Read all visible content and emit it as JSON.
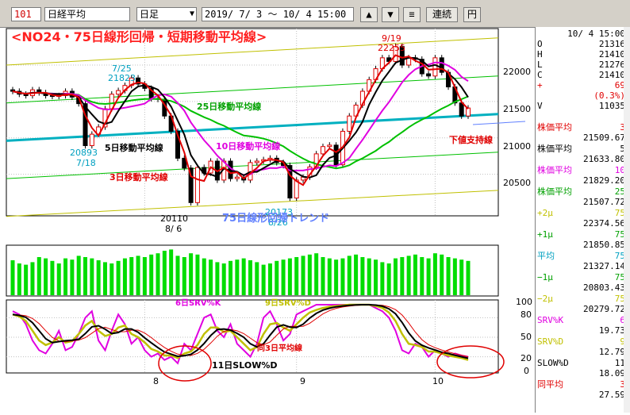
{
  "toolbar": {
    "code": "101",
    "name": "日経平均",
    "period": "日足",
    "dropdown_arrow": "▼",
    "date_range": "2019/ 7/ 3 〜 10/ 4 15:00",
    "up_label": "▲",
    "down_label": "▼",
    "menu_label": "≡",
    "rendou_label": "連続",
    "yen_label": "円"
  },
  "chart": {
    "title": "<NO24・75日線形回帰・短期移動平均線>",
    "annotations": {
      "high_date": "9/19",
      "high_value": "22255",
      "jul_high_date": "7/25",
      "jul_high_value": "21823",
      "jul_low_value": "20893",
      "jul_low_date": "7/18",
      "aug_low_value": "20110",
      "aug_low_date": "8/ 6",
      "aug2_low_value": "20173",
      "aug2_low_date": "8/26",
      "ma25": "25日移動平均線",
      "ma5": "5日移動平均線",
      "ma10": "10日移動平均線",
      "ma3": "3日移動平均線",
      "trend": "75日線形回帰トレンド",
      "support": "下値支持線",
      "srvk": "6日SRV%K",
      "srvd": "9日SRV%D",
      "same": "同3日平均線",
      "slowd": "11日SLOW%D"
    },
    "price_axis": [
      "22000",
      "21500",
      "21000",
      "20500"
    ],
    "osc_axis": [
      "100",
      "80",
      "50",
      "20",
      "0"
    ],
    "x_labels": [
      "8",
      "9",
      "10"
    ]
  },
  "quote": {
    "datetime": "10/ 4 15:00",
    "rows": [
      {
        "l": "O",
        "r": "21316"
      },
      {
        "l": "H",
        "r": "21410"
      },
      {
        "l": "L",
        "r": "21276"
      },
      {
        "l": "C",
        "r": "21410"
      },
      {
        "l": "+",
        "r": "69"
      },
      {
        "l": "",
        "r": "(0.3%)"
      },
      {
        "l": "V",
        "r": "11035"
      }
    ]
  },
  "indicators": [
    {
      "label": "株価平均",
      "n": "3",
      "value": "21509.67",
      "color": "#e00000"
    },
    {
      "label": "株価平均",
      "n": "5",
      "value": "21633.80",
      "color": "#000000"
    },
    {
      "label": "株価平均",
      "n": "10",
      "value": "21829.20",
      "color": "#e000e0"
    },
    {
      "label": "株価平均",
      "n": "25",
      "value": "21507.72",
      "color": "#00a000"
    },
    {
      "label": "+2μ",
      "n": "75",
      "value": "22374.56",
      "color": "#c0c000"
    },
    {
      "label": "+1μ",
      "n": "75",
      "value": "21850.85",
      "color": "#00a000"
    },
    {
      "label": "平均",
      "n": "75",
      "value": "21327.14",
      "color": "#00a0c0"
    },
    {
      "label": "−1μ",
      "n": "75",
      "value": "20803.43",
      "color": "#00a000"
    },
    {
      "label": "−2μ",
      "n": "75",
      "value": "20279.72",
      "color": "#c0c000"
    },
    {
      "label": "SRV%K",
      "n": "6",
      "value": "19.73",
      "color": "#e000e0"
    },
    {
      "label": "SRV%D",
      "n": "9",
      "value": "12.79",
      "color": "#c0c000"
    },
    {
      "label": "SLOW%D",
      "n": "11",
      "value": "18.09",
      "color": "#000000"
    },
    {
      "label": "同平均",
      "n": "3",
      "value": "27.59",
      "color": "#e00000"
    }
  ],
  "colors": {
    "candle_up": "#e00000",
    "candle_down": "#000000",
    "ma3": "#e00000",
    "ma5": "#000000",
    "ma10": "#e000e0",
    "ma25": "#00c000",
    "trend": "#00b0c0",
    "band1": "#00c000",
    "band2": "#c0c000",
    "volume": "#00dd00",
    "circle": "#e00000"
  },
  "chart_data": {
    "type": "line",
    "price_series": {
      "name": "日経平均",
      "close": [
        21640,
        21600,
        21580,
        21660,
        21620,
        21580,
        21570,
        21580,
        21640,
        21560,
        21470,
        20893,
        21050,
        21150,
        21400,
        21600,
        21650,
        21720,
        21823,
        21740,
        21680,
        21540,
        21530,
        21300,
        21090,
        20720,
        20585,
        20110,
        20593,
        20517,
        20680,
        20420,
        20680,
        20440,
        20460,
        20420,
        20660,
        20680,
        20700,
        20720,
        20660,
        20620,
        20173,
        20420,
        20460,
        20600,
        20780,
        20880,
        20900,
        20630,
        21090,
        21300,
        21450,
        21640,
        21800,
        21950,
        22100,
        22050,
        22255,
        22000,
        22100,
        22080,
        21880,
        21850,
        22100,
        21900,
        21700,
        21480,
        21300,
        21410
      ]
    },
    "volume": [
      55,
      50,
      48,
      52,
      60,
      58,
      54,
      50,
      58,
      56,
      62,
      60,
      58,
      55,
      52,
      50,
      54,
      58,
      60,
      62,
      60,
      64,
      66,
      70,
      72,
      62,
      60,
      66,
      64,
      58,
      56,
      52,
      50,
      54,
      56,
      58,
      55,
      52,
      48,
      50,
      54,
      56,
      58,
      60,
      62,
      64,
      66,
      60,
      58,
      56,
      58,
      62,
      64,
      60,
      58,
      56,
      52,
      50,
      58,
      60,
      62,
      64,
      60,
      58,
      66,
      64,
      60,
      58,
      56,
      54
    ],
    "srv_k": [
      90,
      85,
      70,
      45,
      30,
      25,
      40,
      60,
      30,
      35,
      55,
      80,
      90,
      45,
      30,
      60,
      85,
      70,
      40,
      50,
      30,
      20,
      25,
      15,
      20,
      10,
      40,
      30,
      55,
      80,
      85,
      60,
      50,
      70,
      40,
      30,
      20,
      40,
      80,
      90,
      70,
      45,
      55,
      85,
      90,
      95,
      100,
      100,
      100,
      100,
      100,
      100,
      100,
      100,
      100,
      95,
      90,
      80,
      60,
      30,
      25,
      40,
      35,
      20,
      30,
      25,
      20,
      25,
      22,
      20
    ],
    "srv_d": [
      85,
      82,
      75,
      60,
      45,
      38,
      42,
      50,
      42,
      44,
      55,
      68,
      75,
      60,
      52,
      55,
      65,
      68,
      55,
      50,
      42,
      32,
      28,
      22,
      22,
      18,
      25,
      28,
      38,
      55,
      65,
      65,
      58,
      60,
      50,
      40,
      30,
      35,
      55,
      70,
      72,
      65,
      60,
      70,
      80,
      88,
      92,
      95,
      97,
      98,
      99,
      100,
      100,
      100,
      100,
      98,
      95,
      88,
      75,
      55,
      40,
      38,
      35,
      28,
      28,
      25,
      22,
      20,
      18,
      15
    ],
    "x_ticks": [
      "8",
      "9",
      "10"
    ],
    "ylabel": "",
    "osc_range": [
      0,
      100
    ]
  }
}
